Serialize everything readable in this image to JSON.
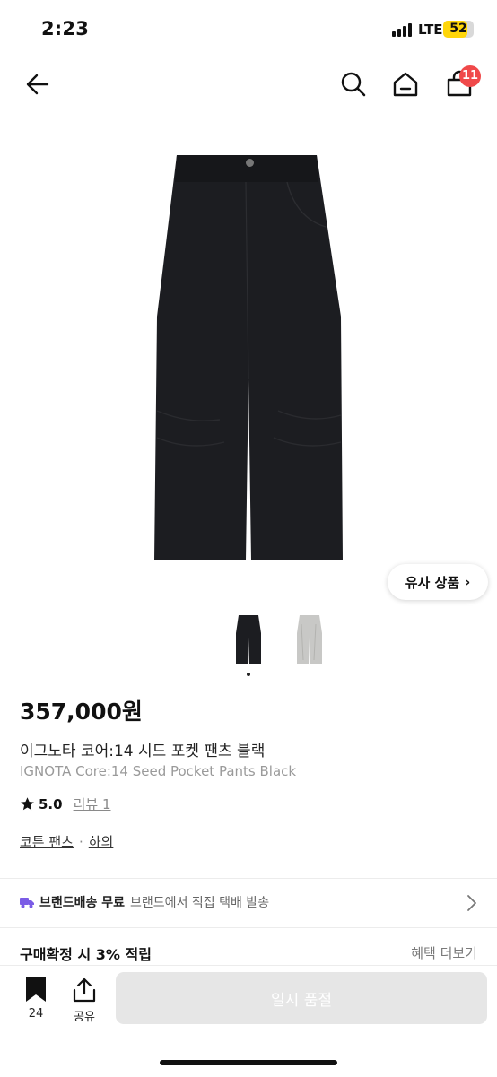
{
  "status_bar": {
    "time": "2:23",
    "network": "LTE",
    "battery": "52"
  },
  "header": {
    "back_icon": "arrow-left-icon",
    "search_icon": "search-icon",
    "home_icon": "home-icon",
    "cart_icon": "shopping-bag-icon",
    "cart_count": "11"
  },
  "gallery": {
    "similar_button": "유사 상품",
    "similar_chevron": "›",
    "thumbnails": [
      "black",
      "gray"
    ],
    "active_index": 1
  },
  "product": {
    "price": "357,000원",
    "name_ko": "이그노타 코어:14 시드 포켓 팬츠 블랙",
    "name_en": "IGNOTA Core:14 Seed Pocket Pants Black",
    "rating": "5.0",
    "review": "리뷰 1",
    "category_1": "코튼 팬츠",
    "category_sep": "·",
    "category_2": "하의"
  },
  "shipping": {
    "icon": "truck-icon",
    "label": "브랜드배송 무료",
    "detail": "브랜드에서 직접 택배 발송"
  },
  "points": {
    "label": "구매확정 시 3% 적립",
    "more": "혜택 더보기"
  },
  "bottom": {
    "bookmark_count": "24",
    "share_label": "공유",
    "soldout_label": "일시 품절"
  },
  "colors": {
    "accent_badge": "#f0494a",
    "battery": "#ffd60a",
    "truck": "#7b5ce6"
  }
}
